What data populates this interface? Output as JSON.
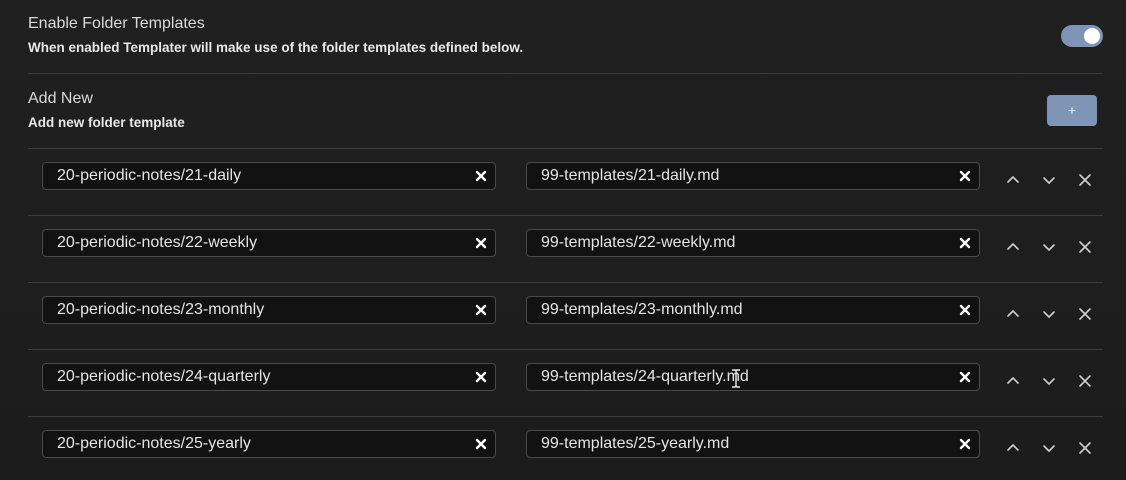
{
  "enable_setting": {
    "name": "Enable Folder Templates",
    "description": "When enabled Templater will make use of the folder templates defined below.",
    "toggle_on": true,
    "toggle_color": "#7f95b5"
  },
  "add_setting": {
    "name": "Add New",
    "description": "Add new folder template",
    "button_label": "+",
    "button_color": "#7f95b5"
  },
  "templates": [
    {
      "folder": "20-periodic-notes/21-daily",
      "template": "99-templates/21-daily.md"
    },
    {
      "folder": "20-periodic-notes/22-weekly",
      "template": "99-templates/22-weekly.md"
    },
    {
      "folder": "20-periodic-notes/23-monthly",
      "template": "99-templates/23-monthly.md"
    },
    {
      "folder": "20-periodic-notes/24-quarterly",
      "template": "99-templates/24-quarterly.md"
    },
    {
      "folder": "20-periodic-notes/25-yearly",
      "template": "99-templates/25-yearly.md"
    }
  ],
  "icons": {
    "clear": "close-icon",
    "move_up": "chevron-up-icon",
    "move_down": "chevron-down-icon",
    "delete": "close-icon",
    "cursor": "text-cursor-icon"
  }
}
